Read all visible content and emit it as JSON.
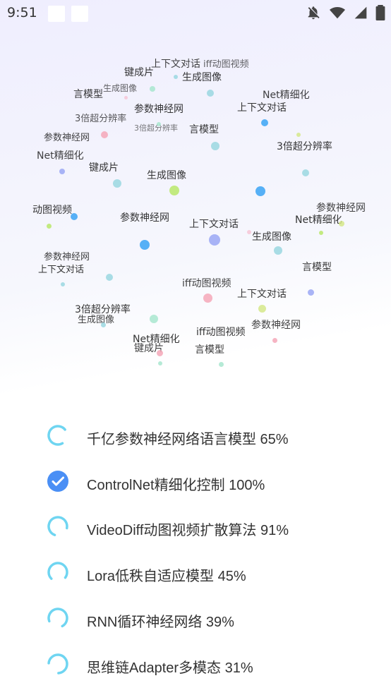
{
  "status_bar": {
    "time": "9:51",
    "icons": [
      "notification-square",
      "notification-square",
      "notifications-off-icon",
      "wifi-icon",
      "signal-icon",
      "battery-icon"
    ]
  },
  "cloud": {
    "words": [
      "上下文对话",
      "iff动图视频",
      "键成片",
      "生成图像",
      "言模型",
      "参数神经网",
      "生成图像",
      "Net精细化",
      "上下文对话",
      "3倍超分辨率",
      "参数神经网",
      "3倍超分辨率",
      "Net精细化",
      "键成片",
      "生成图像",
      "参数神经网",
      "言模型",
      "3倍超分辨率",
      "动图视频",
      "参数神经网",
      "生成图像",
      "上下文对话",
      "参数神经网",
      "上下文对话",
      "言模型",
      "iff动图视频",
      "Net精细化",
      "3倍超分辨率",
      "生成图像",
      "言模型",
      "上下文对话",
      "iff动图视频",
      "Net精细化",
      "键成片",
      "参数神经网"
    ]
  },
  "tasks": [
    {
      "label": "千亿参数神经网络语言模型 65%",
      "status": "loading",
      "progress": 0.65
    },
    {
      "label": "ControlNet精细化控制 100%",
      "status": "done",
      "progress": 1.0
    },
    {
      "label": "VideoDiff动图视频扩散算法 91%",
      "status": "loading",
      "progress": 0.91
    },
    {
      "label": "Lora低秩自适应模型 45%",
      "status": "loading",
      "progress": 0.45
    },
    {
      "label": "RNN循环神经网络 39%",
      "status": "loading",
      "progress": 0.39
    },
    {
      "label": "思维链Adapter多模态 31%",
      "status": "loading",
      "progress": 0.31
    }
  ],
  "colors": {
    "accent": "#4a8ff5",
    "spinner": "#5fd0f0",
    "dots": [
      "#3aa3f5",
      "#a8e6cf",
      "#9ad7e0",
      "#b9e86a",
      "#f4a7b9",
      "#9aa7f5",
      "#f7c6d6",
      "#d5e88a"
    ]
  }
}
